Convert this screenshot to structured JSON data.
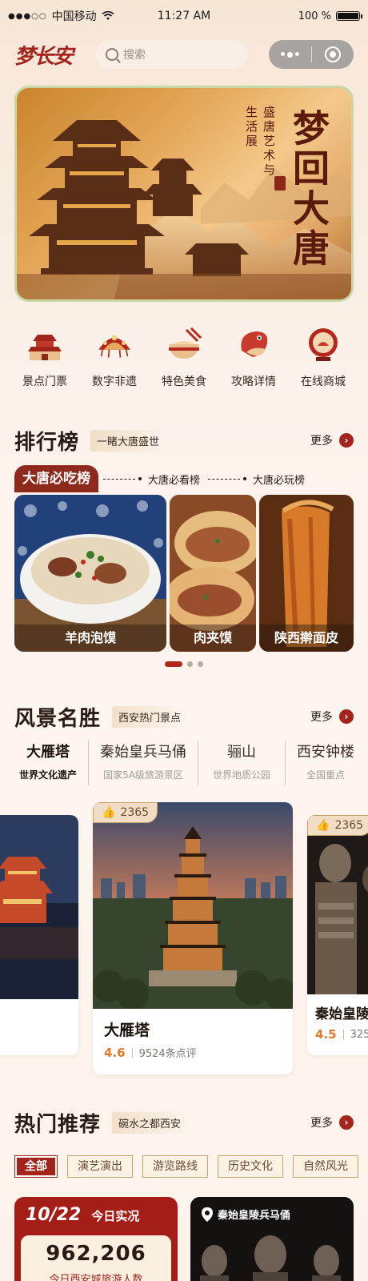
{
  "status": {
    "carrier": "中国移动",
    "time": "11:27 AM",
    "battery": "100 %",
    "signal": "●●●○○"
  },
  "header": {
    "logo": "梦长安",
    "search_placeholder": "搜索"
  },
  "banner": {
    "title": "梦回大唐",
    "sub1": "盛唐艺术与",
    "sub2": "生活展"
  },
  "nav": [
    {
      "label": "景点门票",
      "icon": "gate-tower-icon"
    },
    {
      "label": "数字非遗",
      "icon": "opera-headdress-icon"
    },
    {
      "label": "特色美食",
      "icon": "noodle-bowl-icon"
    },
    {
      "label": "攻略详情",
      "icon": "koi-fish-icon"
    },
    {
      "label": "在线商城",
      "icon": "lantern-icon"
    }
  ],
  "ranking": {
    "title": "排行榜",
    "subtitle": "一睹大唐盛世",
    "more": "更多",
    "tabs": [
      "大唐必吃榜",
      "大唐必看榜",
      "大唐必玩榜"
    ],
    "foods": [
      "羊肉泡馍",
      "肉夹馍",
      "陕西擀面皮"
    ]
  },
  "scenic": {
    "title": "风景名胜",
    "subtitle": "西安热门景点",
    "more": "更多",
    "tabs": [
      {
        "title": "大雁塔",
        "sub": "世界文化遗产"
      },
      {
        "title": "秦始皇兵马俑",
        "sub": "国家5A级旅游景区"
      },
      {
        "title": "骊山",
        "sub": "世界地质公园"
      },
      {
        "title": "西安钟楼",
        "sub": "全国重点"
      }
    ],
    "cards": [
      {
        "name": "大雁塔",
        "likes": "2365",
        "rating": "4.6",
        "reviews": "9524条点评"
      },
      {
        "name": "秦始皇陵",
        "likes": "2365",
        "rating": "4.5",
        "reviews": "325"
      }
    ]
  },
  "hot": {
    "title": "热门推荐",
    "subtitle": "碗水之都西安",
    "more": "更多",
    "tabs": [
      "全部",
      "演艺演出",
      "游览路线",
      "历史文化",
      "自然风光"
    ],
    "live": {
      "date": "10/22",
      "label": "今日实况",
      "number": "962,206",
      "desc": "今日西安城旅游人数"
    },
    "loc": {
      "label": "秦始皇陵兵马俑"
    }
  }
}
